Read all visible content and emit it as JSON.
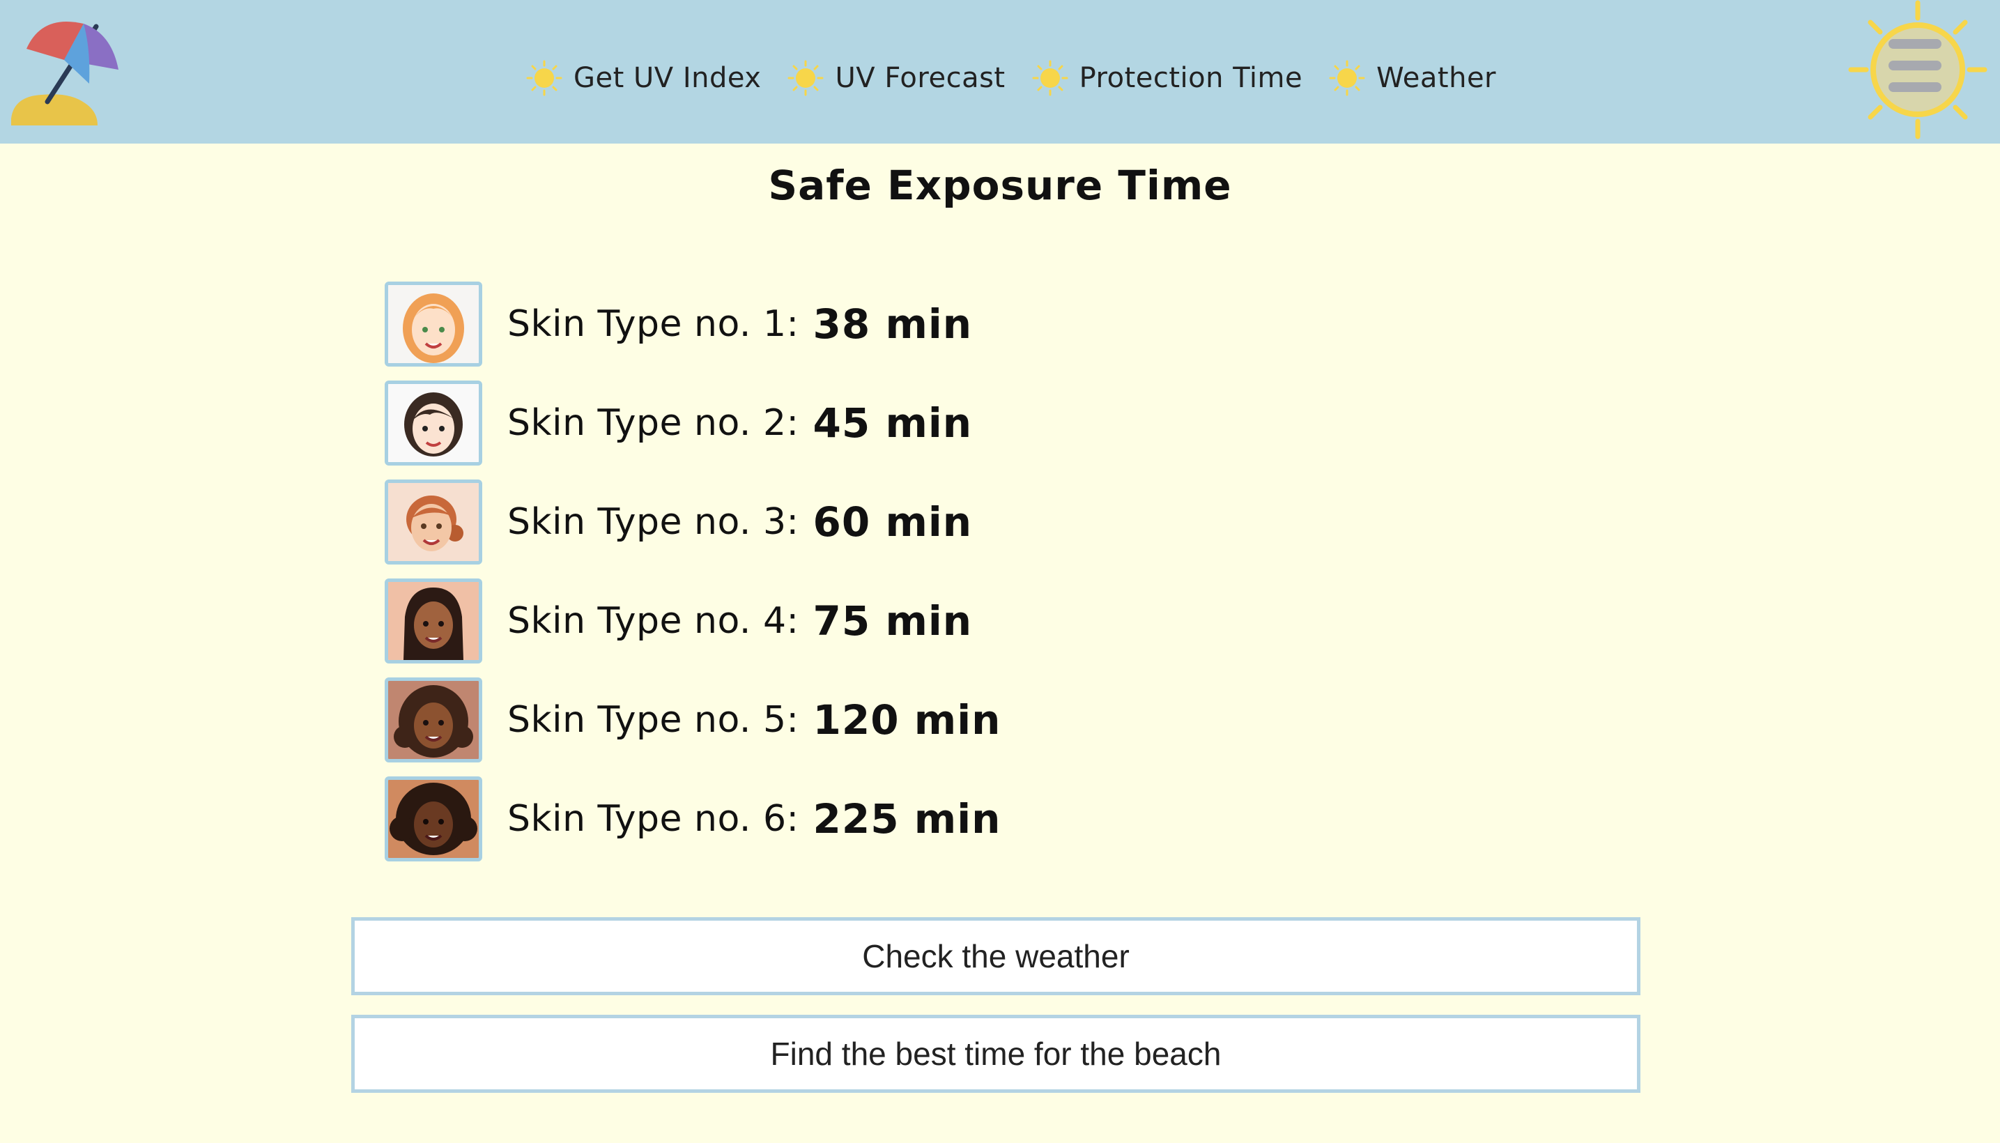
{
  "header": {
    "logo_icon": "beach-umbrella-icon",
    "menu_icon": "sun-hamburger-menu-icon",
    "nav": [
      {
        "label": "Get UV Index",
        "icon": "sun-icon"
      },
      {
        "label": "UV Forecast",
        "icon": "sun-icon"
      },
      {
        "label": "Protection Time",
        "icon": "sun-icon"
      },
      {
        "label": "Weather",
        "icon": "sun-icon"
      }
    ]
  },
  "main": {
    "title": "Safe Exposure Time",
    "skin_types": [
      {
        "label": "Skin Type no. 1:",
        "value": "38 min",
        "icon": "skin-type-1-avatar"
      },
      {
        "label": "Skin Type no. 2:",
        "value": "45 min",
        "icon": "skin-type-2-avatar"
      },
      {
        "label": "Skin Type no. 3:",
        "value": "60 min",
        "icon": "skin-type-3-avatar"
      },
      {
        "label": "Skin Type no. 4:",
        "value": "75 min",
        "icon": "skin-type-4-avatar"
      },
      {
        "label": "Skin Type no. 5:",
        "value": "120 min",
        "icon": "skin-type-5-avatar"
      },
      {
        "label": "Skin Type no. 6:",
        "value": "225 min",
        "icon": "skin-type-6-avatar"
      }
    ],
    "buttons": {
      "check_weather": "Check the weather",
      "best_time": "Find the best time for the beach"
    }
  },
  "colors": {
    "header_bg": "#b3d6e3",
    "page_bg": "#fefee4",
    "sun": "#f7d64a",
    "button_border": "#b3d3e3"
  }
}
